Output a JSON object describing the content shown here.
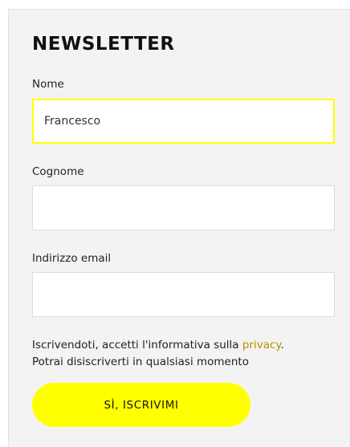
{
  "newsletter": {
    "title": "NEWSLETTER",
    "fields": [
      {
        "label": "Nome",
        "value": "Francesco",
        "placeholder": ""
      },
      {
        "label": "Cognome",
        "value": "",
        "placeholder": ""
      },
      {
        "label": "Indirizzo email",
        "value": "",
        "placeholder": ""
      }
    ],
    "consent_prefix": "Iscrivendoti, accetti l'informativa sulla ",
    "privacy_link": "privacy",
    "consent_suffix": ".",
    "unsubscribe_note": "Potrai disiscriverti in qualsiasi momento",
    "submit_label": "SÌ, ISCRIVIMI"
  },
  "colors": {
    "accent_yellow": "#ffff00",
    "link_gold": "#b58f00",
    "panel_bg": "#f3f3f3"
  }
}
